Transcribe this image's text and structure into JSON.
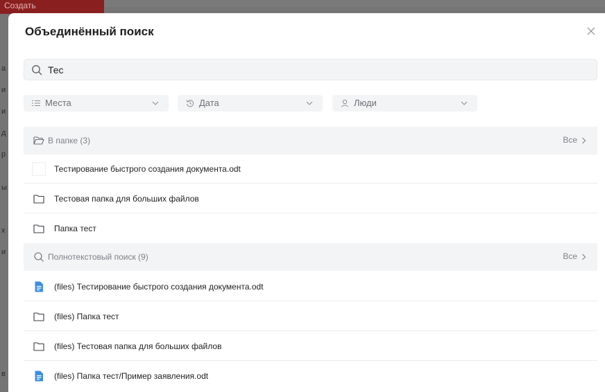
{
  "background": {
    "create_label": "Создать"
  },
  "modal": {
    "title": "Объединённый поиск"
  },
  "search": {
    "value": "Тес",
    "placeholder": ""
  },
  "filters": [
    {
      "label": "Места",
      "icon": "list-icon"
    },
    {
      "label": "Дата",
      "icon": "history-icon"
    },
    {
      "label": "Люди",
      "icon": "person-icon"
    }
  ],
  "sections": [
    {
      "label": "В папке (3)",
      "all_label": "Все",
      "icon": "folder-open-icon",
      "items": [
        {
          "label": "Тестирование быстрого создания документа.odt",
          "icon": "blank-file-icon"
        },
        {
          "label": "Тестовая папка для больших файлов",
          "icon": "folder-icon"
        },
        {
          "label": "Папка тест",
          "icon": "folder-icon"
        }
      ]
    },
    {
      "label": "Полнотекстовый поиск (9)",
      "all_label": "Все",
      "icon": "search-icon",
      "items": [
        {
          "label": "(files) Тестирование быстрого создания документа.odt",
          "icon": "document-icon"
        },
        {
          "label": "(files) Папка тест",
          "icon": "folder-icon"
        },
        {
          "label": "(files) Тестовая папка для больших файлов",
          "icon": "folder-icon"
        },
        {
          "label": "(files) Папка тест/Пример заявления.odt",
          "icon": "document-icon"
        }
      ]
    }
  ],
  "colors": {
    "accent_blue": "#3b8fe0",
    "section_bg": "#f3f4f5",
    "create_red": "#8a1f1f"
  }
}
